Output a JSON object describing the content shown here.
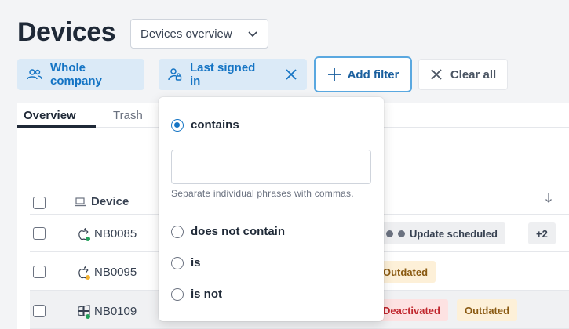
{
  "page": {
    "title": "Devices"
  },
  "view_select": {
    "value": "Devices overview"
  },
  "filters": {
    "company": "Whole company",
    "last_signed_in": "Last signed in",
    "add_filter": "Add filter",
    "clear_all": "Clear all"
  },
  "tabs": [
    {
      "label": "Overview",
      "active": true
    },
    {
      "label": "Trash",
      "active": false
    }
  ],
  "table": {
    "header": {
      "device": "Device",
      "sort_icon": "arrow-down-icon"
    },
    "rows": [
      {
        "os": "apple-icon",
        "status_color": "#22a05a",
        "name": "NB0085",
        "badges": [
          "Update scheduled",
          "+2"
        ]
      },
      {
        "os": "apple-icon",
        "status_color": "#f2b233",
        "name": "NB0095",
        "badges": [
          "Outdated"
        ]
      },
      {
        "os": "windows-icon",
        "status_color": "#22a05a",
        "name": "NB0109",
        "badges": [
          "Deactivated",
          "Outdated"
        ]
      }
    ]
  },
  "dropdown": {
    "options": [
      {
        "label": "contains",
        "selected": true
      },
      {
        "label": "does not contain",
        "selected": false
      },
      {
        "label": "is",
        "selected": false
      },
      {
        "label": "is not",
        "selected": false
      }
    ],
    "input_value": "",
    "hint": "Separate individual phrases with commas."
  },
  "colors": {
    "accent": "#1474c4",
    "chip_bg": "#dbeaf7",
    "outdated_bg": "#fdf0d8",
    "deactivated_bg": "#fde2e2"
  }
}
